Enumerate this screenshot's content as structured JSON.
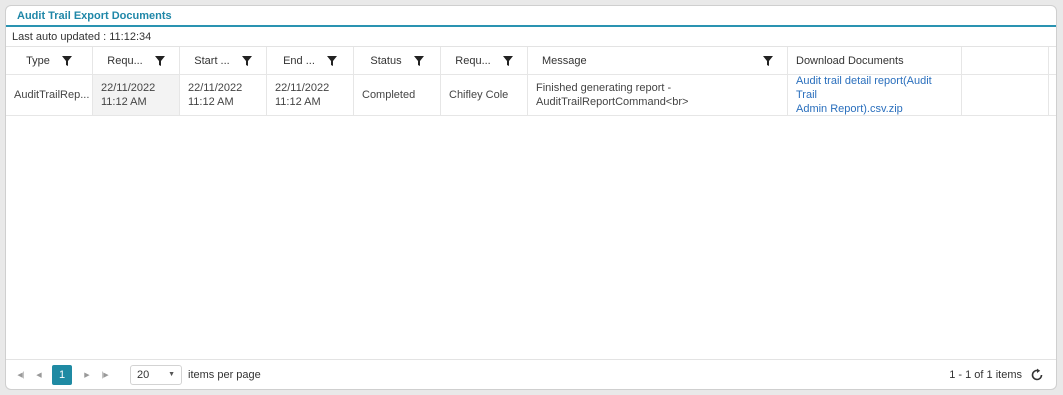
{
  "panel": {
    "title": "Audit Trail Export Documents",
    "last_updated": "Last auto updated : 11:12:34"
  },
  "grid": {
    "columns": [
      {
        "key": "type",
        "label": "Type"
      },
      {
        "key": "requested",
        "label": "Requ..."
      },
      {
        "key": "start",
        "label": "Start ..."
      },
      {
        "key": "end",
        "label": "End ..."
      },
      {
        "key": "status",
        "label": "Status"
      },
      {
        "key": "requested_by",
        "label": "Requ..."
      },
      {
        "key": "message",
        "label": "Message"
      },
      {
        "key": "download",
        "label": "Download Documents"
      }
    ],
    "rows": [
      {
        "type": "AuditTrailRep...",
        "requested_date": "22/11/2022",
        "requested_time": "11:12 AM",
        "start_date": "22/11/2022",
        "start_time": "11:12 AM",
        "end_date": "22/11/2022",
        "end_time": "11:12 AM",
        "status": "Completed",
        "requested_by": "Chifley Cole",
        "message_line1": "Finished generating report -",
        "message_line2": "AuditTrailReportCommand<br>",
        "download_line1": "Audit trail detail report(Audit Trail",
        "download_line2": "Admin Report).csv.zip"
      }
    ]
  },
  "pager": {
    "current_page": "1",
    "page_size": "20",
    "items_per_page_label": "items per page",
    "items_info": "1 - 1 of 1 items"
  },
  "icons": {
    "filter": "filter-icon",
    "first": "first-page-icon",
    "prev": "prev-page-icon",
    "next": "next-page-icon",
    "last": "last-page-icon",
    "refresh": "refresh-icon"
  },
  "colors": {
    "accent": "#1f87a8",
    "link": "#2a6fbd",
    "page_active": "#1f8aa3"
  }
}
